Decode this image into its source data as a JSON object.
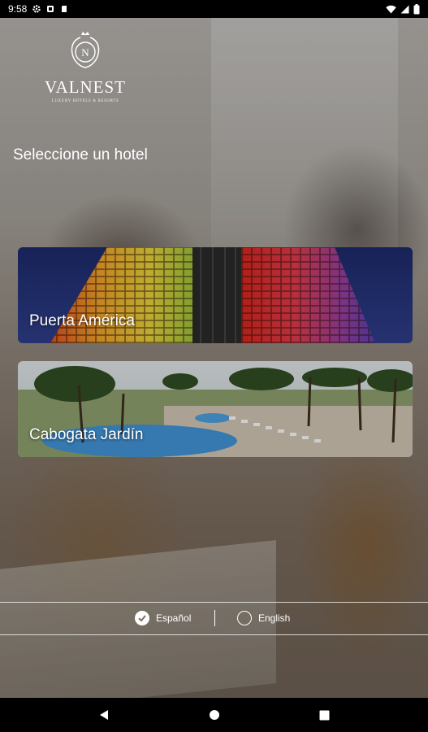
{
  "status_bar": {
    "time": "9:58",
    "left_icons": [
      "settings-icon",
      "app-icon",
      "sd-card-icon"
    ],
    "right_icons": [
      "wifi-icon",
      "signal-icon",
      "battery-icon"
    ]
  },
  "brand": {
    "name": "VALNEST",
    "tagline": "LUXURY HOTELS & RESORTS",
    "emblem_letter": "N"
  },
  "heading": "Seleccione un hotel",
  "hotels": [
    {
      "name": "Puerta América"
    },
    {
      "name": "Cabogata Jardín"
    }
  ],
  "languages": [
    {
      "label": "Español",
      "selected": true
    },
    {
      "label": "English",
      "selected": false
    }
  ],
  "nav_bar": [
    "back-icon",
    "home-icon",
    "recents-icon"
  ]
}
